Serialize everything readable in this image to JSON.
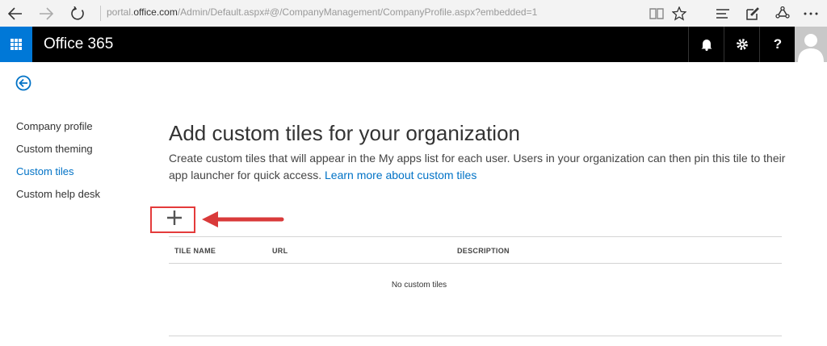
{
  "browser": {
    "url_prefix": "portal.",
    "url_host": "office.com",
    "url_path": "/Admin/Default.aspx#@/CompanyManagement/CompanyProfile.aspx?embedded=1"
  },
  "suite": {
    "brand": "Office 365",
    "help_label": "?"
  },
  "nav": {
    "items": [
      {
        "label": "Company profile"
      },
      {
        "label": "Custom theming"
      },
      {
        "label": "Custom tiles"
      },
      {
        "label": "Custom help desk"
      }
    ],
    "active_index": 2
  },
  "main": {
    "title": "Add custom tiles for your organization",
    "description": "Create custom tiles that will appear in the My apps list for each user. Users in your organization can then pin this tile to their app launcher for quick access.",
    "learn_more": "Learn more about custom tiles",
    "add_label": "+"
  },
  "table": {
    "columns": [
      "TILE NAME",
      "URL",
      "DESCRIPTION"
    ],
    "empty_text": "No custom tiles"
  },
  "colors": {
    "accent": "#0072c6",
    "waffle": "#0078d7",
    "highlight": "#e43b3b"
  }
}
